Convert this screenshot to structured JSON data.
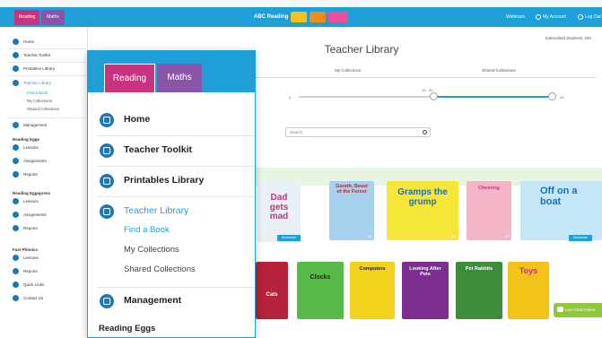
{
  "topbar": {
    "tabs": [
      "Reading",
      "Maths"
    ],
    "logo_text": "ABC Reading",
    "links": [
      "Webinars",
      "My Account",
      "Log Out"
    ]
  },
  "sidebar": {
    "items": [
      {
        "label": "Home",
        "icon": "home-icon"
      },
      {
        "label": "Teacher Toolkit",
        "icon": "toolkit-icon"
      },
      {
        "label": "Printables Library",
        "icon": "printables-icon"
      },
      {
        "label": "Teacher Library",
        "icon": "library-icon",
        "active": true
      },
      {
        "label": "Management",
        "icon": "management-icon"
      }
    ],
    "library_sub": [
      "Find a Book",
      "My Collections",
      "Shared Collections"
    ],
    "groups": [
      {
        "heading": "Reading Eggs",
        "items": [
          "Lessons",
          "Assignments",
          "Reports"
        ]
      },
      {
        "heading": "Reading Eggspress",
        "items": [
          "Lessons",
          "Assignments",
          "Reports"
        ]
      },
      {
        "heading": "Fast Phonics",
        "items": [
          "Lessons",
          "Reports"
        ]
      }
    ],
    "footer": [
      "Quick Links",
      "Contact Us"
    ]
  },
  "main": {
    "title": "Teacher Library",
    "subscribed": "Subscribed Students: 240",
    "subtabs": [
      "My Collections",
      "Shared Collections"
    ],
    "slider": {
      "min_label": "0",
      "mid_label": "15 - 20",
      "max_label": "24",
      "low": 15,
      "high": 24
    },
    "search_placeholder": "Search",
    "books_row1": [
      {
        "title": "Dad gets mad",
        "number": ""
      },
      {
        "title": "Gareth, Beast of the Forest",
        "number": "14"
      },
      {
        "title": "Gramps the grump",
        "number": "14"
      },
      {
        "title": "Cheering",
        "number": "10"
      },
      {
        "title": "Off on a boat",
        "number": ""
      }
    ],
    "books_row2": [
      {
        "title": "Cats",
        "number": ""
      },
      {
        "title": "Clocks",
        "number": ""
      },
      {
        "title": "Computers",
        "number": ""
      },
      {
        "title": "Looking After Pets",
        "number": ""
      },
      {
        "title": "Pet Rabbits",
        "number": ""
      },
      {
        "title": "Toys",
        "number": ""
      }
    ],
    "pick_label": "Bookmark",
    "chat_label": "Live Chat Online"
  },
  "zoom": {
    "tabs": [
      "Reading",
      "Maths"
    ],
    "items": [
      {
        "label": "Home"
      },
      {
        "label": "Teacher Toolkit"
      },
      {
        "label": "Printables Library"
      },
      {
        "label": "Teacher Library",
        "active": true
      }
    ],
    "sub": [
      "Find a Book",
      "My Collections",
      "Shared Collections"
    ],
    "management": "Management",
    "heading": "Reading Eggs"
  }
}
